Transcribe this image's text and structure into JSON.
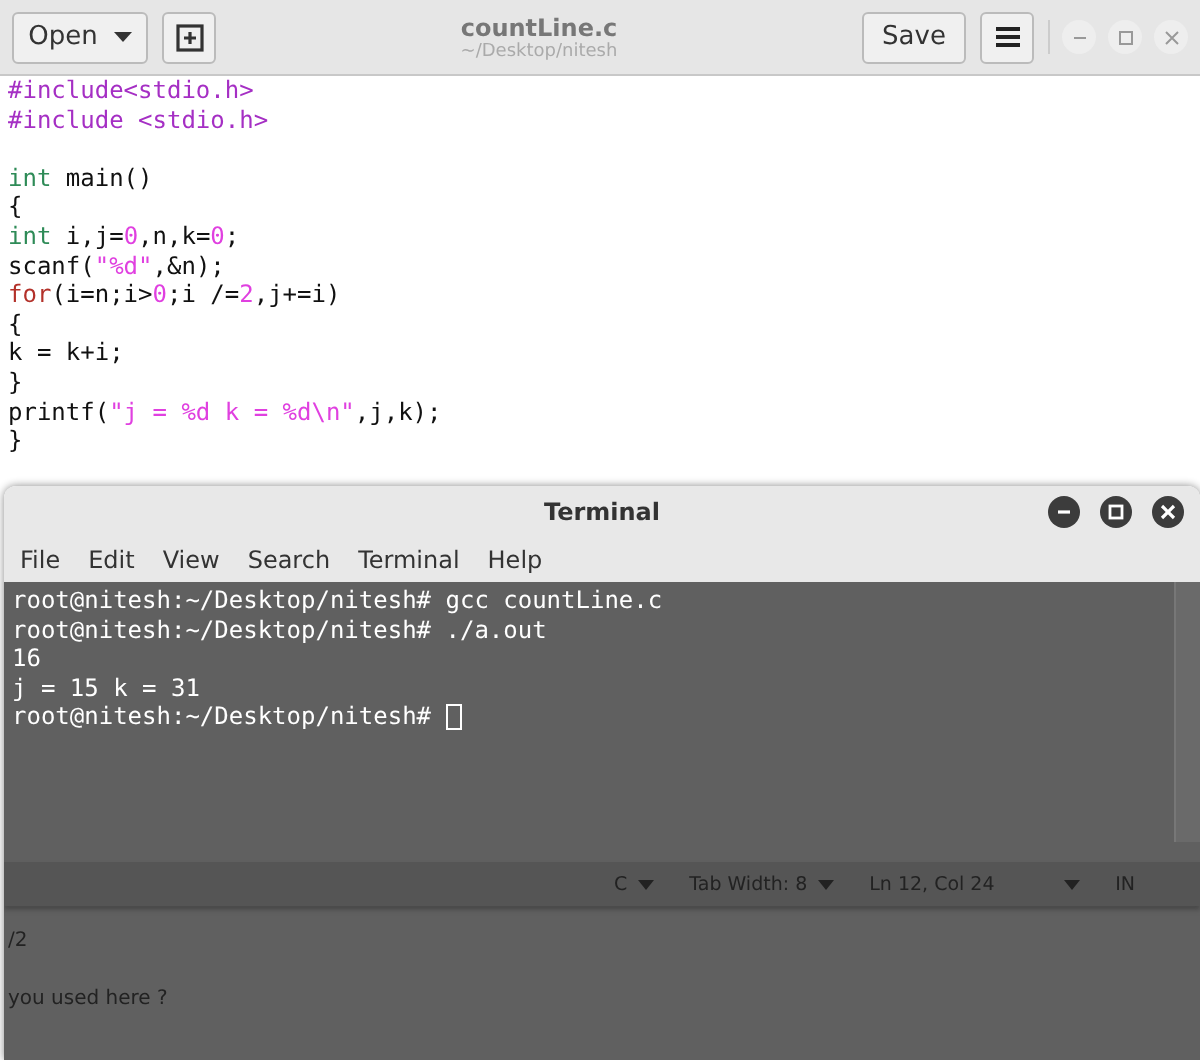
{
  "editor": {
    "open_button": "Open",
    "title": "countLine.c",
    "subtitle": "~/Desktop/nitesh",
    "save_button": "Save",
    "code_blocks": [
      [
        [
          {
            "text": "#include<stdio.h>",
            "kind": "preproc"
          }
        ],
        [
          {
            "text": "#include <stdio.h>",
            "kind": "preproc"
          }
        ]
      ],
      [
        [
          {
            "text": "int",
            "kind": "type"
          },
          {
            "text": " main()",
            "kind": "plain"
          }
        ],
        [
          {
            "text": "{",
            "kind": "plain"
          }
        ],
        [
          {
            "text": "int",
            "kind": "type"
          },
          {
            "text": " i,j=",
            "kind": "plain"
          },
          {
            "text": "0",
            "kind": "literal"
          },
          {
            "text": ",n,k=",
            "kind": "plain"
          },
          {
            "text": "0",
            "kind": "literal"
          },
          {
            "text": ";",
            "kind": "plain"
          }
        ],
        [
          {
            "text": "scanf(",
            "kind": "plain"
          },
          {
            "text": "\"%d\"",
            "kind": "literal"
          },
          {
            "text": ",&n);",
            "kind": "plain"
          }
        ],
        [
          {
            "text": "for",
            "kind": "keyword"
          },
          {
            "text": "(i=n;i>",
            "kind": "plain"
          },
          {
            "text": "0",
            "kind": "literal"
          },
          {
            "text": ";i /=",
            "kind": "plain"
          },
          {
            "text": "2",
            "kind": "literal"
          },
          {
            "text": ",j+=i)",
            "kind": "plain"
          }
        ],
        [
          {
            "text": "{",
            "kind": "plain"
          }
        ],
        [
          {
            "text": "k = k+i;",
            "kind": "plain"
          }
        ],
        [
          {
            "text": "}",
            "kind": "plain"
          }
        ],
        [
          {
            "text": "printf(",
            "kind": "plain"
          },
          {
            "text": "\"j = %d k = %d\\n\"",
            "kind": "literal"
          },
          {
            "text": ",j,k);",
            "kind": "plain"
          }
        ],
        [
          {
            "text": "}",
            "kind": "plain"
          }
        ]
      ]
    ],
    "status_bar": {
      "language": "C",
      "tab_width": "Tab Width: 8",
      "position": "Ln 12, Col 24",
      "mode": "IN"
    }
  },
  "terminal": {
    "title": "Terminal",
    "menu": [
      "File",
      "Edit",
      "View",
      "Search",
      "Terminal",
      "Help"
    ],
    "output": [
      "root@nitesh:~/Desktop/nitesh# gcc countLine.c",
      "root@nitesh:~/Desktop/nitesh# ./a.out",
      "16",
      "j = 15 k = 31"
    ],
    "prompt": "root@nitesh:~/Desktop/nitesh# "
  },
  "background_text": [
    "/2",
    "you used here ?"
  ]
}
